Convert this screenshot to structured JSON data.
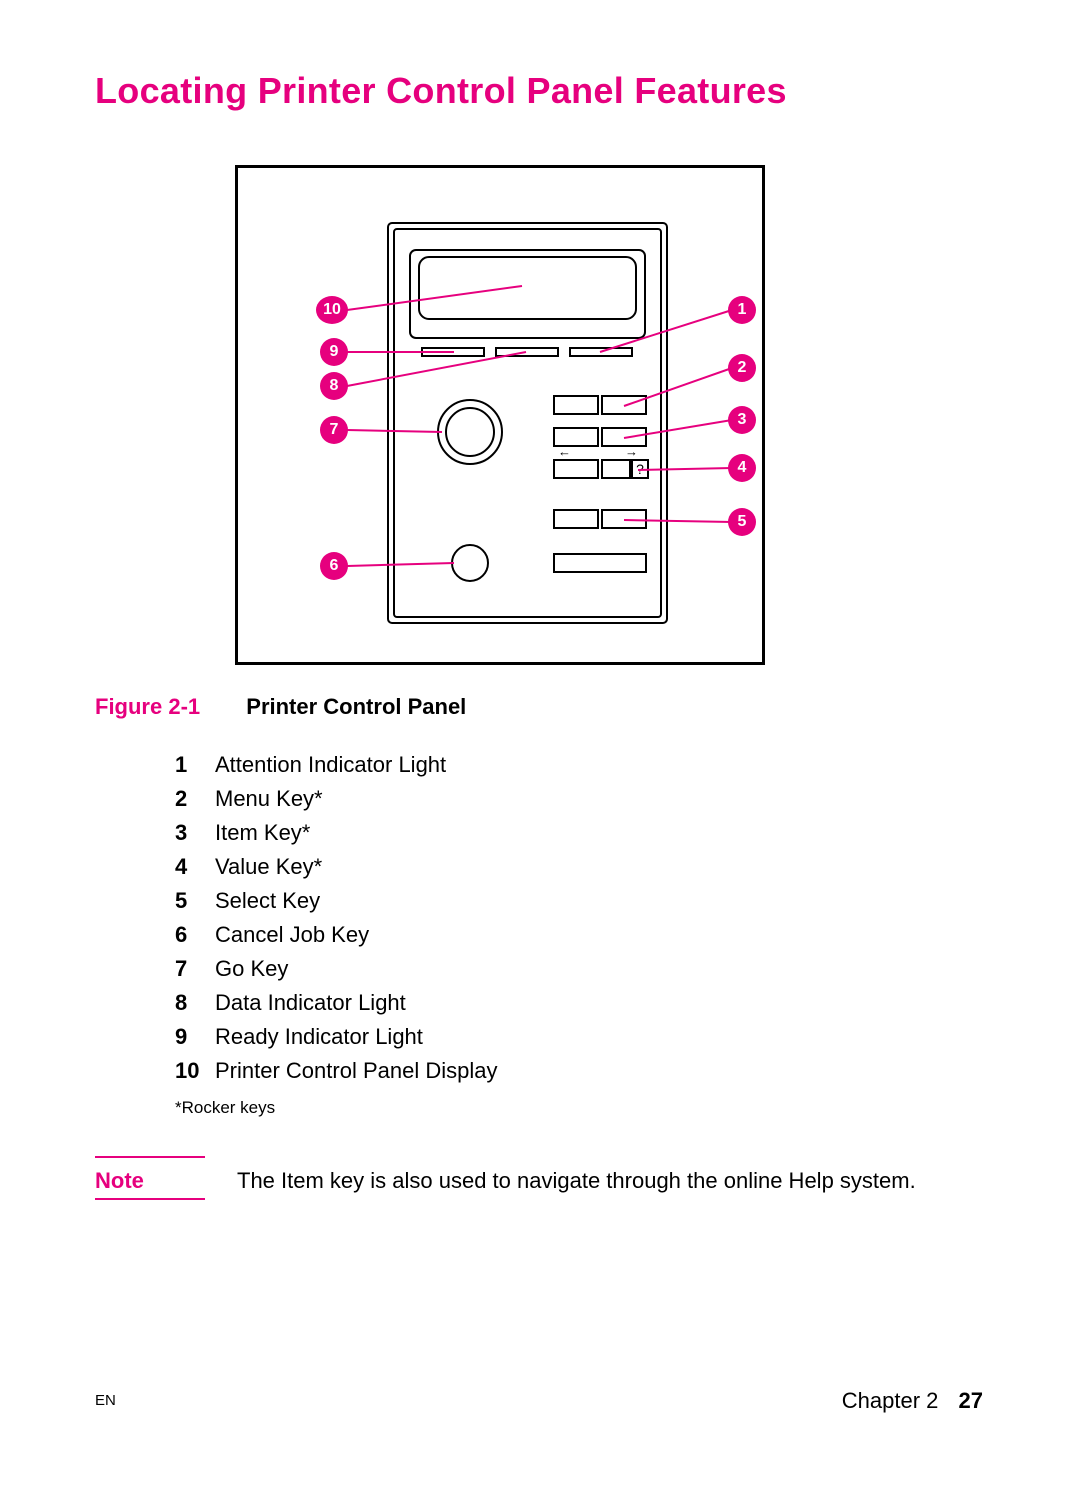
{
  "title": "Locating Printer Control Panel Features",
  "figure": {
    "label": "Figure 2-1",
    "title": "Printer Control Panel",
    "callouts": {
      "c1": "1",
      "c2": "2",
      "c3": "3",
      "c4": "4",
      "c5": "5",
      "c6": "6",
      "c7": "7",
      "c8": "8",
      "c9": "9",
      "c10": "10"
    }
  },
  "legend": {
    "items": [
      {
        "num": "1",
        "label": "Attention Indicator Light"
      },
      {
        "num": "2",
        "label": "Menu Key*"
      },
      {
        "num": "3",
        "label": "Item Key*"
      },
      {
        "num": "4",
        "label": "Value Key*"
      },
      {
        "num": "5",
        "label": "Select Key"
      },
      {
        "num": "6",
        "label": "Cancel Job Key"
      },
      {
        "num": "7",
        "label": "Go Key"
      },
      {
        "num": "8",
        "label": "Data Indicator Light"
      },
      {
        "num": "9",
        "label": "Ready Indicator Light"
      },
      {
        "num": "10",
        "label": "Printer Control Panel Display"
      }
    ],
    "footnote": "*Rocker keys"
  },
  "note": {
    "label": "Note",
    "text": "The Item key is also used to navigate through the online Help system."
  },
  "footer": {
    "en": "EN",
    "chapter": "Chapter 2",
    "page": "27"
  }
}
